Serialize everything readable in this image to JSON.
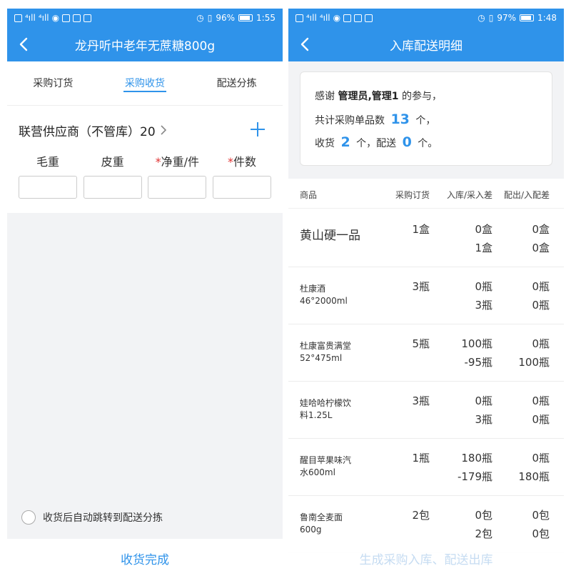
{
  "left": {
    "status": {
      "battery": "96%",
      "time": "1:55"
    },
    "title": "龙丹听中老年无蔗糖800g",
    "tabs": [
      "采购订货",
      "采购收货",
      "配送分拣"
    ],
    "active_tab": 1,
    "supplier": "联营供应商（不管库）20",
    "fields": [
      {
        "label": "毛重",
        "required": false
      },
      {
        "label": "皮重",
        "required": false
      },
      {
        "label": "净重/件",
        "required": true
      },
      {
        "label": "件数",
        "required": true
      }
    ],
    "required_mark": "*",
    "auto_jump_label": "收货后自动跳转到配送分拣",
    "bottom_button": "收货完成"
  },
  "right": {
    "status": {
      "battery": "97%",
      "time": "1:48"
    },
    "title": "入库配送明细",
    "summary": {
      "l1_pre": "感谢",
      "user": "管理员,管理1",
      "l1_post": "的参与，",
      "l2_pre": "共计采购单品数",
      "count": "13",
      "l2_post": "个，",
      "l3_a": "收货",
      "received": "2",
      "l3_b": "个，配送",
      "delivered": "0",
      "l3_c": "个。"
    },
    "columns": [
      "商品",
      "采购订货",
      "入库/采入差",
      "配出/入配差"
    ],
    "rows": [
      {
        "name": "黄山硬一品",
        "name2": "",
        "big": true,
        "order": "1盒",
        "in1": "0盒",
        "in2": "1盒",
        "out1": "0盒",
        "out2": "0盒"
      },
      {
        "name": "杜康酒",
        "name2": "46°2000ml",
        "big": false,
        "order": "3瓶",
        "in1": "0瓶",
        "in2": "3瓶",
        "out1": "0瓶",
        "out2": "0瓶"
      },
      {
        "name": "杜康富贵满堂",
        "name2": "52°475ml",
        "big": false,
        "order": "5瓶",
        "in1": "100瓶",
        "in2": "-95瓶",
        "out1": "0瓶",
        "out2": "100瓶"
      },
      {
        "name": "娃哈哈柠檬饮",
        "name2": "料1.25L",
        "big": false,
        "order": "3瓶",
        "in1": "0瓶",
        "in2": "3瓶",
        "out1": "0瓶",
        "out2": "0瓶"
      },
      {
        "name": "醒目苹果味汽",
        "name2": "水600ml",
        "big": false,
        "order": "1瓶",
        "in1": "180瓶",
        "in2": "-179瓶",
        "out1": "0瓶",
        "out2": "180瓶"
      },
      {
        "name": "鲁南全麦面",
        "name2": "600g",
        "big": false,
        "order": "2包",
        "in1": "0包",
        "in2": "2包",
        "out1": "0包",
        "out2": "0包"
      }
    ],
    "bottom_button": "生成采购入库、配送出库"
  }
}
